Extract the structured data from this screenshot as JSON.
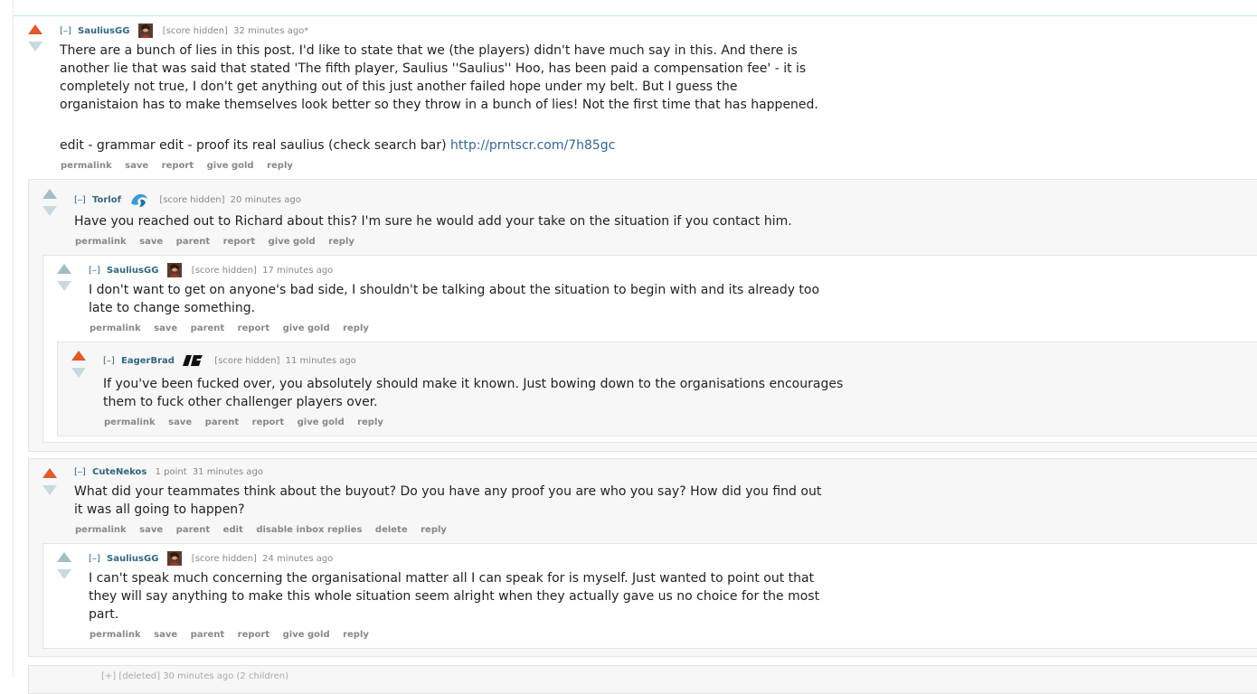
{
  "comments": {
    "c1": {
      "toggle": "[–]",
      "author": "SauliusGG",
      "score": "[score hidden]",
      "time": "32 minutes ago*",
      "body": "There are a bunch of lies in this post. I'd like to state that we (the players) didn't have much say in this. And there is another lie that was said that stated 'The fifth player, Saulius ''Saulius'' Hoo, has been paid a compensation fee' - it is completely not true, I don't get anything out of this just another failed hope under my belt. But I guess the organistaion has to make themselves look better so they throw in a bunch of lies! Not the first time that has happened.",
      "edit": "edit - grammar edit - proof its real saulius (check search bar) ",
      "edit_link": "http://prntscr.com/7h85gc",
      "buttons": [
        "permalink",
        "save",
        "report",
        "give gold",
        "reply"
      ]
    },
    "c2": {
      "toggle": "[–]",
      "author": "Torlof",
      "score": "[score hidden]",
      "time": "20 minutes ago",
      "body": "Have you reached out to Richard about this? I'm sure he would add your take on the situation if you contact him.",
      "buttons": [
        "permalink",
        "save",
        "parent",
        "report",
        "give gold",
        "reply"
      ]
    },
    "c3": {
      "toggle": "[–]",
      "author": "SauliusGG",
      "score": "[score hidden]",
      "time": "17 minutes ago",
      "body": "I don't want to get on anyone's bad side, I shouldn't be talking about the situation to begin with and its already too late to change something.",
      "buttons": [
        "permalink",
        "save",
        "parent",
        "report",
        "give gold",
        "reply"
      ]
    },
    "c4": {
      "toggle": "[–]",
      "author": "EagerBrad",
      "score": "[score hidden]",
      "time": "11 minutes ago",
      "body": "If you've been fucked over, you absolutely should make it known. Just bowing down to the organisations encourages them to fuck other challenger players over.",
      "buttons": [
        "permalink",
        "save",
        "parent",
        "report",
        "give gold",
        "reply"
      ]
    },
    "c5": {
      "toggle": "[–]",
      "author": "CuteNekos",
      "score": "1 point",
      "time": "31 minutes ago",
      "body": "What did your teammates think about the buyout? Do you have any proof you are who you say? How did you find out it was all going to happen?",
      "buttons": [
        "permalink",
        "save",
        "parent",
        "edit",
        "disable inbox replies",
        "delete",
        "reply"
      ]
    },
    "c6": {
      "toggle": "[–]",
      "author": "SauliusGG",
      "score": "[score hidden]",
      "time": "24 minutes ago",
      "body": "I can't speak much concerning the organisational matter all I can speak for is myself. Just wanted to point out that they will say anything to make this whole situation seem alright when they actually gave us no choice for the most part.",
      "buttons": [
        "permalink",
        "save",
        "parent",
        "report",
        "give gold",
        "reply"
      ]
    },
    "c7": {
      "tagline": "[+] [deleted] 30 minutes ago (2 children)"
    }
  },
  "colors": {
    "upvoted": "#e05a2a",
    "arrow_neutral": "#a0bfc4",
    "author": "#336680",
    "link": "#336699"
  }
}
